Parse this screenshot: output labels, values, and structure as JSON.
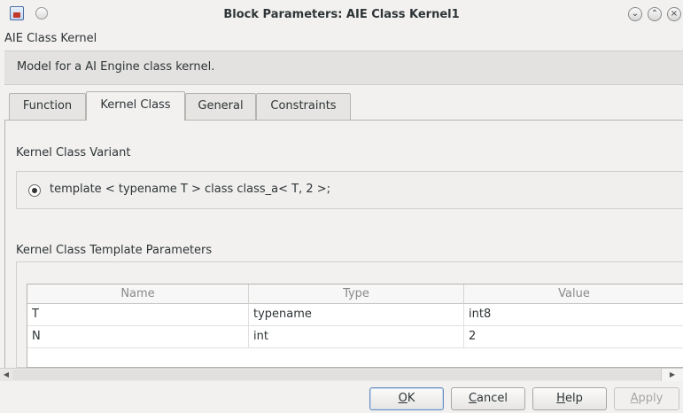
{
  "window": {
    "title": "Block Parameters: AIE Class Kernel1",
    "controls": [
      "minimize-icon",
      "maximize-icon",
      "close-icon"
    ]
  },
  "block": {
    "name": "AIE Class Kernel",
    "description": "Model for a AI Engine class kernel."
  },
  "tabs": [
    {
      "label": "Function"
    },
    {
      "label": "Kernel Class"
    },
    {
      "label": "General"
    },
    {
      "label": "Constraints"
    }
  ],
  "active_tab": "Kernel Class",
  "variant": {
    "heading": "Kernel Class Variant",
    "option": "template < typename T > class class_a< T, 2 >;",
    "selected": true
  },
  "template_params": {
    "heading": "Kernel Class Template Parameters",
    "columns": [
      "Name",
      "Type",
      "Value"
    ],
    "rows": [
      [
        "T",
        "typename",
        "int8"
      ],
      [
        "N",
        "int",
        "2"
      ]
    ]
  },
  "buttons": {
    "ok": {
      "mnemonic": "O",
      "rest": "K"
    },
    "cancel": {
      "mnemonic": "C",
      "rest": "ancel"
    },
    "help": {
      "mnemonic": "H",
      "rest": "elp"
    },
    "apply": {
      "mnemonic": "A",
      "rest": "pply",
      "disabled": true
    }
  },
  "colors": {
    "background": "#f2f1f0",
    "accent_border": "#6a8fc0",
    "disabled_text": "#a6a6a6"
  }
}
